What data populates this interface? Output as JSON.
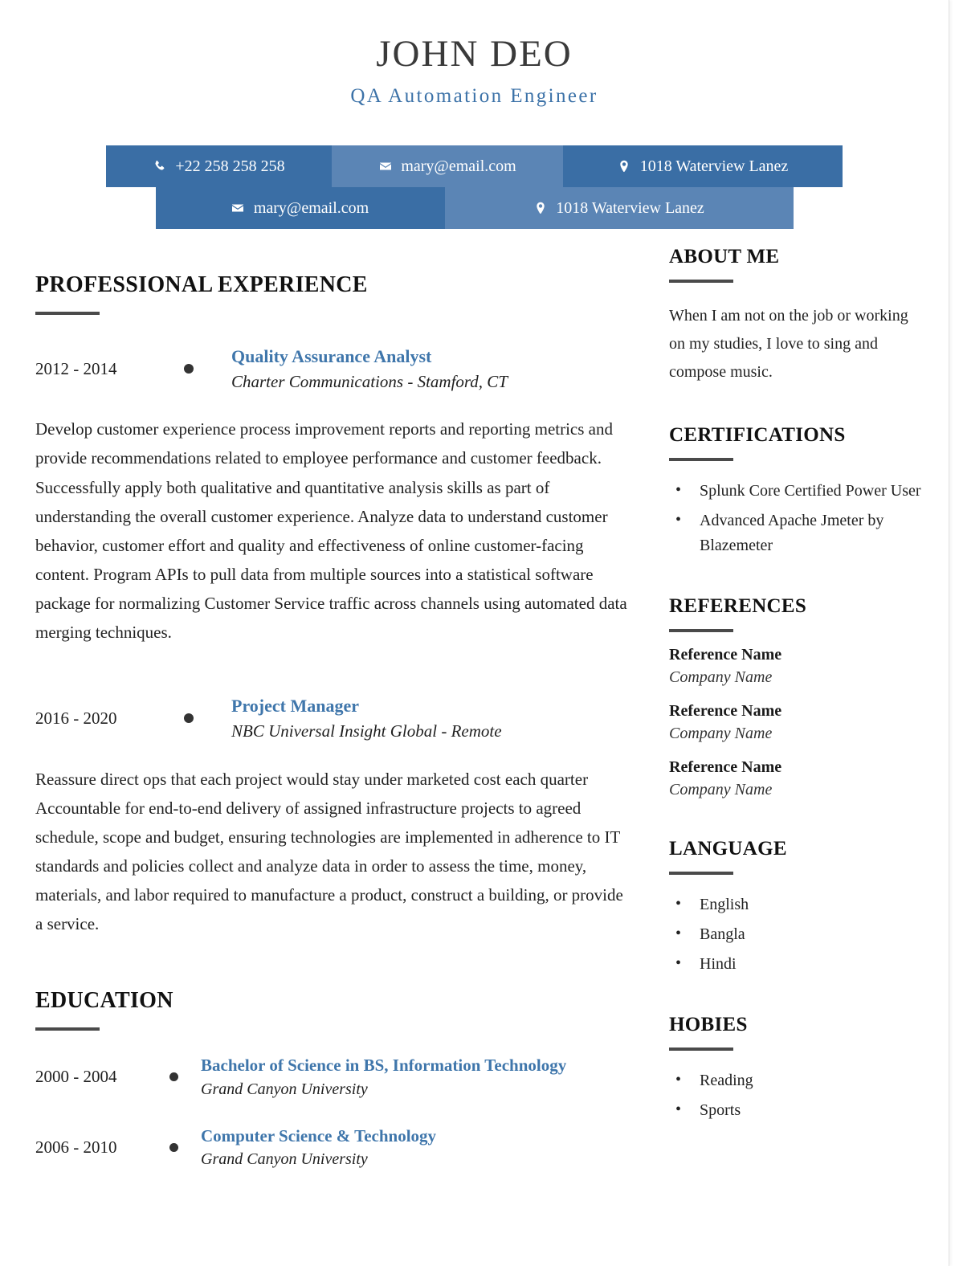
{
  "header": {
    "name": "JOHN DEO",
    "subtitle": "QA Automation Engineer",
    "accent_blue": "#3a6ea5",
    "accent_blue_light": "#5b85b5",
    "link_blue": "#3f76ab"
  },
  "contact": {
    "row1": [
      {
        "icon": "phone-icon",
        "label": "+22 258 258 258",
        "shade": "dark"
      },
      {
        "icon": "envelope-icon",
        "label": "mary@email.com",
        "shade": "light"
      },
      {
        "icon": "location-pin-icon",
        "label": "1018 Waterview Lanez",
        "shade": "dark"
      }
    ],
    "row2": [
      {
        "icon": "envelope-icon",
        "label": "mary@email.com",
        "shade": "dark"
      },
      {
        "icon": "location-pin-icon",
        "label": "1018 Waterview Lanez",
        "shade": "light"
      }
    ]
  },
  "main": {
    "experience": {
      "title": "PROFESSIONAL EXPERIENCE",
      "entries": [
        {
          "date": "2012 - 2014",
          "role": "Quality Assurance Analyst",
          "org": "Charter Communications - Stamford, CT",
          "description": "Develop customer experience process improvement reports and reporting metrics and provide recommendations related to employee performance and customer feedback. Successfully apply both qualitative and quantitative analysis skills as part of understanding the overall customer experience. Analyze data to understand customer behavior, customer effort and quality and effectiveness of online customer-facing content. Program APIs to pull data from multiple sources into a statistical software package for normalizing Customer Service traffic across channels using automated data merging techniques."
        },
        {
          "date": "2016 - 2020",
          "role": "Project Manager",
          "org": "NBC Universal Insight Global - Remote",
          "description": "Reassure direct ops that each project would stay under marketed cost each quarter Accountable for end-to-end delivery of assigned infrastructure projects to agreed schedule, scope and budget, ensuring technologies are implemented in adherence to IT standards and policies collect and analyze data in order to assess the time, money, materials, and labor required to manufacture a product, construct a building, or provide a service."
        }
      ]
    },
    "education": {
      "title": "EDUCATION",
      "entries": [
        {
          "date": "2000 - 2004",
          "role": "Bachelor of Science in BS, Information Technology",
          "org": "Grand Canyon University"
        },
        {
          "date": "2006 - 2010",
          "role": "Computer Science & Technology",
          "org": "Grand Canyon University"
        }
      ]
    }
  },
  "sidebar": {
    "about": {
      "title": "ABOUT ME",
      "text": "When I am not on the job or working on my studies, I love to sing and compose music."
    },
    "certifications": {
      "title": "CERTIFICATIONS",
      "items": [
        "Splunk Core Certified Power User",
        "Advanced Apache Jmeter by Blazemeter"
      ]
    },
    "references": {
      "title": "REFERENCES",
      "items": [
        {
          "name": "Reference Name",
          "company": "Company Name"
        },
        {
          "name": "Reference Name",
          "company": "Company Name"
        },
        {
          "name": "Reference Name",
          "company": "Company Name"
        }
      ]
    },
    "language": {
      "title": "LANGUAGE",
      "items": [
        "English",
        "Bangla",
        "Hindi"
      ]
    },
    "hobbies": {
      "title": "HOBIES",
      "items": [
        "Reading",
        "Sports"
      ]
    }
  }
}
